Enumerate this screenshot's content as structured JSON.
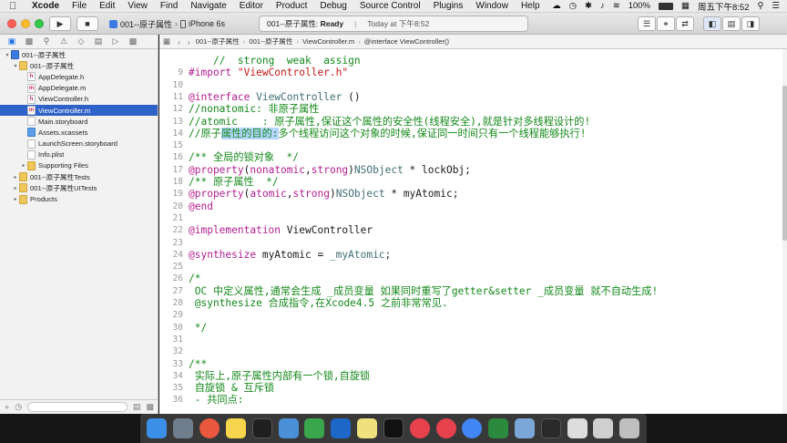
{
  "menubar": {
    "app": "Xcode",
    "menus": [
      "File",
      "Edit",
      "View",
      "Find",
      "Navigate",
      "Editor",
      "Product",
      "Debug",
      "Source Control",
      "Plugins",
      "Window",
      "Help"
    ],
    "battery": "100%",
    "clock": "周五下午8:52"
  },
  "toolbar": {
    "scheme_project": "001--原子属性",
    "scheme_device": "iPhone 6s",
    "activity_project": "001--原子属性:",
    "activity_status": "Ready",
    "activity_time": "Today at 下午8:52"
  },
  "jumpbar": {
    "crumbs": [
      "001--原子属性",
      "001--原子属性",
      "ViewController.m",
      "@interface ViewController()"
    ]
  },
  "navigator": {
    "items": [
      {
        "label": "001--原子属性",
        "kind": "proj",
        "depth": 0,
        "disclosure": "▾"
      },
      {
        "label": "001--原子属性",
        "kind": "folder",
        "depth": 1,
        "disclosure": "▾"
      },
      {
        "label": "AppDelegate.h",
        "kind": "h",
        "depth": 2,
        "disclosure": ""
      },
      {
        "label": "AppDelegate.m",
        "kind": "m",
        "depth": 2,
        "disclosure": ""
      },
      {
        "label": "ViewController.h",
        "kind": "h",
        "depth": 2,
        "disclosure": ""
      },
      {
        "label": "ViewController.m",
        "kind": "m",
        "depth": 2,
        "disclosure": "",
        "selected": true
      },
      {
        "label": "Main.storyboard",
        "kind": "sb",
        "depth": 2,
        "disclosure": ""
      },
      {
        "label": "Assets.xcassets",
        "kind": "xc",
        "depth": 2,
        "disclosure": ""
      },
      {
        "label": "LaunchScreen.storyboard",
        "kind": "sb",
        "depth": 2,
        "disclosure": ""
      },
      {
        "label": "Info.plist",
        "kind": "plist",
        "depth": 2,
        "disclosure": ""
      },
      {
        "label": "Supporting Files",
        "kind": "folder",
        "depth": 2,
        "disclosure": "▸"
      },
      {
        "label": "001--原子属性Tests",
        "kind": "folder",
        "depth": 1,
        "disclosure": "▸"
      },
      {
        "label": "001--原子属性UITests",
        "kind": "folder",
        "depth": 1,
        "disclosure": "▸"
      },
      {
        "label": "Products",
        "kind": "folder",
        "depth": 1,
        "disclosure": "▸"
      }
    ]
  },
  "editor": {
    "partial_top_line": "//  strong  weak  assign",
    "lines": [
      {
        "n": "",
        "segs": [
          [
            "pl",
            ""
          ]
        ]
      },
      {
        "n": "9",
        "segs": [
          [
            "kw",
            "#import "
          ],
          [
            "str",
            "\"ViewController.h\""
          ]
        ]
      },
      {
        "n": "10",
        "segs": [
          [
            "pl",
            ""
          ]
        ]
      },
      {
        "n": "11",
        "segs": [
          [
            "kw",
            "@interface "
          ],
          [
            "ty",
            "ViewController"
          ],
          [
            "pl",
            " ()"
          ]
        ]
      },
      {
        "n": "12",
        "segs": [
          [
            "cm",
            "//nonatomic: 非原子属性"
          ]
        ]
      },
      {
        "n": "13",
        "segs": [
          [
            "cm",
            "//atomic    : 原子属性,保证这个属性的安全性(线程安全),就是针对多线程设计的!"
          ]
        ]
      },
      {
        "n": "14",
        "segs": [
          [
            "cm",
            "//原子"
          ],
          [
            "cmsel",
            "属性的目的:"
          ],
          [
            "cm",
            "多个线程访问这个对象的时候,保证同一时间只有一个线程能够执行!"
          ]
        ]
      },
      {
        "n": "15",
        "segs": [
          [
            "pl",
            ""
          ]
        ]
      },
      {
        "n": "16",
        "segs": [
          [
            "cm",
            "/** 全局的锁对象  */"
          ]
        ]
      },
      {
        "n": "17",
        "segs": [
          [
            "kw",
            "@property"
          ],
          [
            "pl",
            "("
          ],
          [
            "kw",
            "nonatomic"
          ],
          [
            "pl",
            ","
          ],
          [
            "kw",
            "strong"
          ],
          [
            "pl",
            ")"
          ],
          [
            "ty",
            "NSObject"
          ],
          [
            "pl",
            " * lockObj;"
          ]
        ]
      },
      {
        "n": "18",
        "segs": [
          [
            "cm",
            "/** 原子属性  */"
          ]
        ]
      },
      {
        "n": "19",
        "segs": [
          [
            "kw",
            "@property"
          ],
          [
            "pl",
            "("
          ],
          [
            "kw",
            "atomic"
          ],
          [
            "pl",
            ","
          ],
          [
            "kw",
            "strong"
          ],
          [
            "pl",
            ")"
          ],
          [
            "ty",
            "NSObject"
          ],
          [
            "pl",
            " * myAtomic;"
          ]
        ]
      },
      {
        "n": "20",
        "segs": [
          [
            "kw",
            "@end"
          ]
        ]
      },
      {
        "n": "21",
        "segs": [
          [
            "pl",
            ""
          ]
        ]
      },
      {
        "n": "22",
        "segs": [
          [
            "kw",
            "@implementation "
          ],
          [
            "pl",
            "ViewController"
          ]
        ]
      },
      {
        "n": "23",
        "segs": [
          [
            "pl",
            ""
          ]
        ]
      },
      {
        "n": "24",
        "segs": [
          [
            "kw",
            "@synthesize "
          ],
          [
            "pl",
            "myAtomic = "
          ],
          [
            "ty",
            "_myAtomic"
          ],
          [
            "pl",
            ";"
          ]
        ]
      },
      {
        "n": "25",
        "segs": [
          [
            "pl",
            ""
          ]
        ]
      },
      {
        "n": "26",
        "segs": [
          [
            "cm",
            "/*"
          ]
        ]
      },
      {
        "n": "27",
        "segs": [
          [
            "cm",
            " OC 中定义属性,通常会生成 _成员变量 如果同时重写了getter&setter _成员变量 就不自动生成!"
          ]
        ]
      },
      {
        "n": "28",
        "segs": [
          [
            "cm",
            " @synthesize 合成指令,在Xcode4.5 之前非常常见."
          ]
        ]
      },
      {
        "n": "29",
        "segs": [
          [
            "cm",
            ""
          ]
        ]
      },
      {
        "n": "30",
        "segs": [
          [
            "cm",
            " */"
          ]
        ]
      },
      {
        "n": "31",
        "segs": [
          [
            "pl",
            ""
          ]
        ]
      },
      {
        "n": "32",
        "segs": [
          [
            "pl",
            ""
          ]
        ]
      },
      {
        "n": "33",
        "segs": [
          [
            "cm",
            "/**"
          ]
        ]
      },
      {
        "n": "34",
        "segs": [
          [
            "cm",
            " 实际上,原子属性内部有一个锁,自旋锁"
          ]
        ]
      },
      {
        "n": "35",
        "segs": [
          [
            "cm",
            " 自旋锁 & 互斥锁"
          ]
        ]
      },
      {
        "n": "36",
        "segs": [
          [
            "cm",
            " - 共同点:"
          ]
        ]
      }
    ]
  },
  "colors": {
    "keyword": "#b21f90",
    "string": "#c41a16",
    "comment": "#14891a",
    "type": "#3f6e74",
    "selection": "#b5d5ff",
    "nav_selected": "#2f62c8"
  },
  "dock": {
    "icons": [
      "finder-icon",
      "launchpad-icon",
      "photos-icon",
      "notes-icon",
      "qq-icon",
      "mail-icon",
      "evernote-icon",
      "teamviewer-icon",
      "stickies-icon",
      "webstorm-icon",
      "recorder-icon",
      "recorder2-icon",
      "chrome-icon",
      "activity-icon",
      "preview-icon",
      "terminal-icon",
      "keyboard-icon",
      "files-icon",
      "trash-icon"
    ],
    "icon_colors": [
      "#3b8fe6",
      "#6f7d8c",
      "#e9573f",
      "#f6d44b",
      "#1f1f1f",
      "#4a90d9",
      "#3aa64b",
      "#1d67c9",
      "#efe27c",
      "#111111",
      "#e8414e",
      "#e8414e",
      "#4285f4",
      "#2b8a3e",
      "#7aa7d8",
      "#2a2a2a",
      "#dddddd",
      "#cfcfcf",
      "#bfbfbf"
    ]
  }
}
